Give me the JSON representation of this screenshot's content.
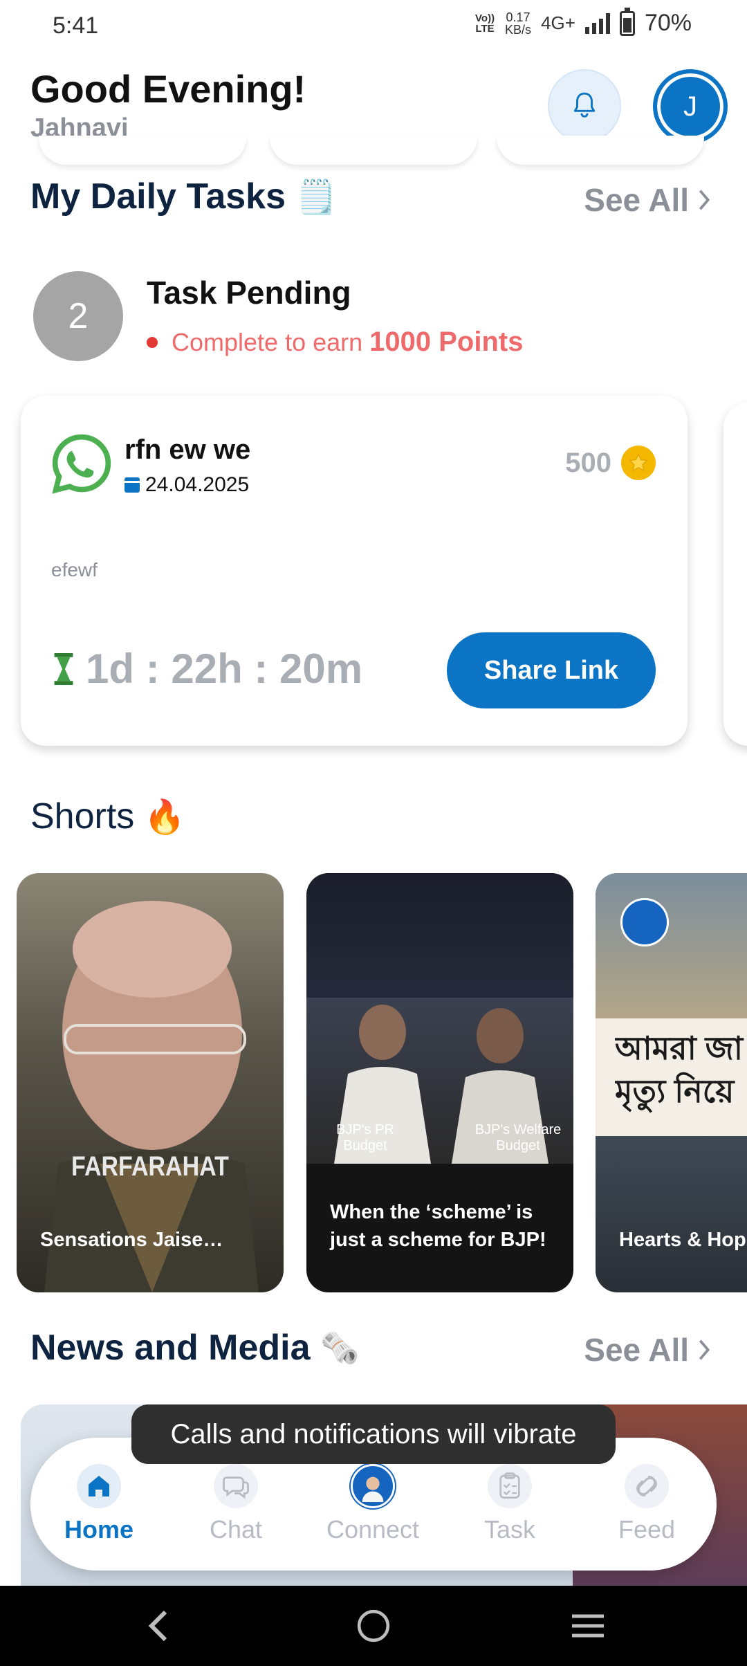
{
  "status_bar": {
    "time": "5:41",
    "volte": "Vo)) LTE",
    "speed_value": "0.17",
    "speed_unit": "KB/s",
    "network": "4G+",
    "battery": "70%"
  },
  "header": {
    "greeting": "Good Evening!",
    "user_name": "Jahnavi",
    "avatar_initial": "J"
  },
  "daily_tasks": {
    "title": "My Daily Tasks",
    "title_emoji": "🗒️",
    "see_all": "See All",
    "pending_count": "2",
    "pending_title": "Task Pending",
    "pending_sub_prefix": "Complete to earn",
    "pending_points": "1000 Points",
    "card": {
      "title": "rfn ew we",
      "date": "24.04.2025",
      "points": "500",
      "description": "efewf",
      "timer": "1d : 22h : 20m",
      "share_label": "Share Link"
    }
  },
  "shorts": {
    "title": "Shorts",
    "title_emoji": "🔥",
    "items": [
      {
        "caption": "Sensations Jaise…",
        "overlay": "FARFARAHAT"
      },
      {
        "caption": "When the ‘scheme’ is just a scheme for BJP!",
        "label_left": "BJP's PR Budget",
        "label_right": "BJP's Welfare Budget"
      },
      {
        "caption": "Hearts & Hop",
        "overlay": "আমরা জা মৃত্যু নিয়ে"
      }
    ]
  },
  "news": {
    "title": "News and Media",
    "title_emoji": "🗞️",
    "see_all": "See All"
  },
  "toast": "Calls and notifications will vibrate",
  "bottom_nav": {
    "items": [
      {
        "label": "Home",
        "icon": "home-icon",
        "active": true
      },
      {
        "label": "Chat",
        "icon": "chat-icon"
      },
      {
        "label": "Connect",
        "icon": "connect-avatar-icon"
      },
      {
        "label": "Task",
        "icon": "clipboard-icon"
      },
      {
        "label": "Feed",
        "icon": "feed-icon"
      }
    ]
  },
  "colors": {
    "accent": "#0c74c4",
    "title": "#0d2340",
    "muted": "#8a8f98",
    "pending": "#ef6a6a",
    "whatsapp": "#4caf50",
    "coin": "#f5b800"
  }
}
